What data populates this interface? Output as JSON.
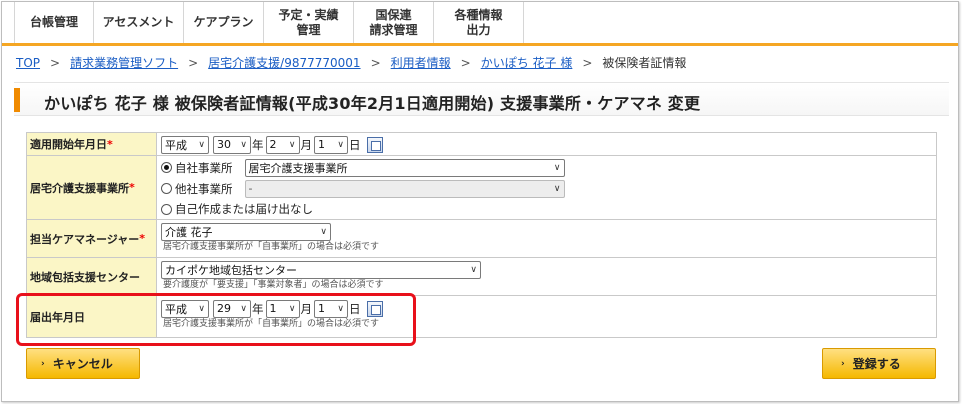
{
  "menu": {
    "items": [
      {
        "label": "台帳管理"
      },
      {
        "label": "アセスメント"
      },
      {
        "label": "ケアプラン"
      },
      {
        "label": "予定・実績\n管理"
      },
      {
        "label": "国保連\n請求管理"
      },
      {
        "label": "各種情報\n出力"
      }
    ]
  },
  "breadcrumb": {
    "items": [
      "TOP",
      "請求業務管理ソフト",
      "居宅介護支援/9877770001",
      "利用者情報",
      "かいぽち 花子 様"
    ],
    "separator": ">",
    "current": "被保険者証情報"
  },
  "page": {
    "title": "かいぽち 花子 様 被保険者証情報(平成30年2月1日適用開始)  支援事業所・ケアマネ  変更"
  },
  "form": {
    "required_mark": "*",
    "start_date": {
      "label": "適用開始年月日",
      "era": "平成",
      "year": "30",
      "year_unit": "年",
      "month": "2",
      "month_unit": "月",
      "day": "1",
      "day_unit": "日"
    },
    "office": {
      "label": "居宅介護支援事業所",
      "own_label": "自社事業所",
      "own_value": "居宅介護支援事業所",
      "other_label": "他社事業所",
      "other_value": "-",
      "self_label": "自己作成または届け出なし"
    },
    "care_manager": {
      "label": "担当ケアマネージャー",
      "value": "介護 花子",
      "note": "居宅介護支援事業所が「自事業所」の場合は必須です"
    },
    "support_center": {
      "label": "地域包括支援センター",
      "value": "カイポケ地域包括センター",
      "note": "要介護度が「要支援」「事業対象者」の場合は必須です"
    },
    "notify_date": {
      "label": "届出年月日",
      "era": "平成",
      "year": "29",
      "year_unit": "年",
      "month": "1",
      "month_unit": "月",
      "day": "1",
      "day_unit": "日",
      "note": "居宅介護支援事業所が「自事業所」の場合は必須です"
    }
  },
  "buttons": {
    "cancel": "キャンセル",
    "register": "登録する",
    "arrow": "›"
  },
  "colors": {
    "accent": "#f5a623",
    "title_accent": "#f08a00",
    "label_bg": "#fbf6c6",
    "required": "#ee0000",
    "highlight": "#e8101a",
    "button": "#f5b800",
    "link": "#1a5dc4"
  }
}
